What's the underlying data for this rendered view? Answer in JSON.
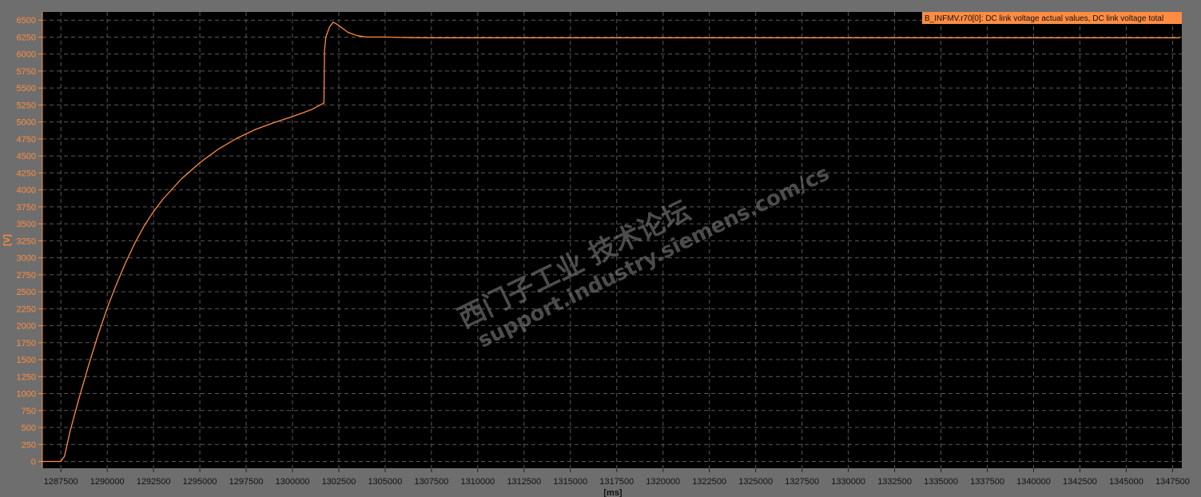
{
  "chart_data": {
    "type": "line",
    "xlabel": "[ms]",
    "ylabel": "[V]",
    "xlim": [
      1286500,
      1348000
    ],
    "ylim": [
      -100,
      6620
    ],
    "x_ticks": [
      1287500,
      1290000,
      1292500,
      1295000,
      1297500,
      1300000,
      1302500,
      1305000,
      1307500,
      1310000,
      1312500,
      1315000,
      1317500,
      1320000,
      1322500,
      1325000,
      1327500,
      1330000,
      1332500,
      1335000,
      1337500,
      1340000,
      1342500,
      1345000,
      1347500
    ],
    "y_ticks": [
      0,
      250,
      500,
      750,
      1000,
      1250,
      1500,
      1750,
      2000,
      2250,
      2500,
      2750,
      3000,
      3250,
      3500,
      3750,
      4000,
      4250,
      4500,
      4750,
      5000,
      5250,
      5500,
      5750,
      6000,
      6250,
      6500
    ],
    "grid": true,
    "legend_position": "top-right",
    "series": [
      {
        "name": "B_INFMV.r70[0]: DC link voltage actual values, DC link voltage total",
        "color": "#ff8c42",
        "x": [
          1286500,
          1287500,
          1287700,
          1288000,
          1288500,
          1289000,
          1289500,
          1290000,
          1290500,
          1291000,
          1291500,
          1292000,
          1292500,
          1293000,
          1294000,
          1295000,
          1296000,
          1297000,
          1298000,
          1299000,
          1300000,
          1301000,
          1301700,
          1301730,
          1301800,
          1302000,
          1302200,
          1302400,
          1302700,
          1303000,
          1303500,
          1304000,
          1304500,
          1305000,
          1306000,
          1307500,
          1310000,
          1320000,
          1330000,
          1340000,
          1347900
        ],
        "y": [
          0,
          0,
          80,
          450,
          950,
          1420,
          1860,
          2260,
          2610,
          2930,
          3220,
          3470,
          3680,
          3860,
          4160,
          4400,
          4600,
          4760,
          4890,
          4990,
          5080,
          5180,
          5280,
          6050,
          6250,
          6400,
          6470,
          6440,
          6380,
          6320,
          6270,
          6250,
          6250,
          6250,
          6245,
          6240,
          6240,
          6240,
          6240,
          6240,
          6240
        ]
      }
    ]
  }
}
